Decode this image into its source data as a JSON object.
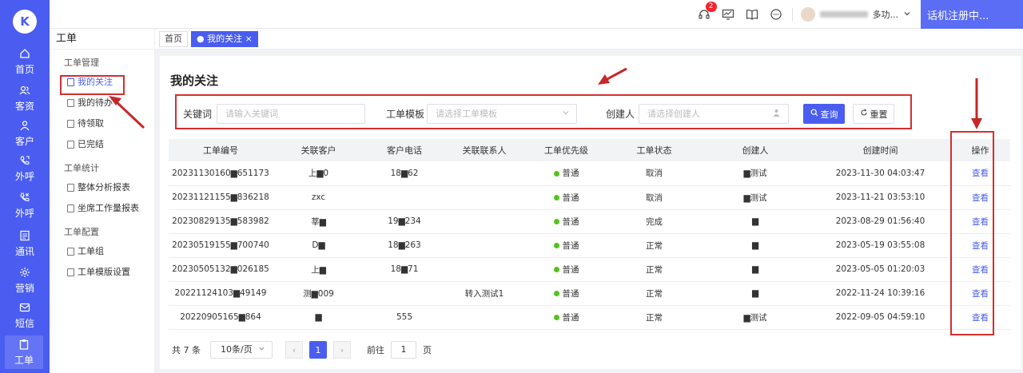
{
  "rail": {
    "logo": "K",
    "items": [
      {
        "label": "首页",
        "icon": "home-icon"
      },
      {
        "label": "客资",
        "icon": "users-icon"
      },
      {
        "label": "客户",
        "icon": "user-icon"
      },
      {
        "label": "外呼",
        "icon": "phone-out-icon"
      },
      {
        "label": "外呼",
        "icon": "phone-call-icon"
      },
      {
        "label": "通讯",
        "icon": "address-book-icon"
      },
      {
        "label": "营销",
        "icon": "gear-icon"
      },
      {
        "label": "短信",
        "icon": "message-icon"
      },
      {
        "label": "工单",
        "icon": "clipboard-icon"
      }
    ]
  },
  "topbar": {
    "badge": "2",
    "user_text": "多功...",
    "register_label": "话机注册中..."
  },
  "sidebar": {
    "title": "工单",
    "groups": [
      {
        "label": "工单管理",
        "items": [
          "我的关注",
          "我的待办",
          "待领取",
          "已完结"
        ]
      },
      {
        "label": "工单统计",
        "items": [
          "整体分析报表",
          "坐席工作量报表"
        ]
      },
      {
        "label": "工单配置",
        "items": [
          "工单组",
          "工单模版设置"
        ]
      }
    ]
  },
  "tabs": {
    "home": "首页",
    "current": "● 我的关注 ×"
  },
  "page": {
    "title": "我的关注",
    "filter": {
      "keyword_label": "关键词",
      "keyword_placeholder": "请输入关键词",
      "template_label": "工单模板",
      "template_placeholder": "请选择工单模板",
      "creator_label": "创建人",
      "creator_placeholder": "请选择创建人",
      "query": "查询",
      "reset": "重置"
    },
    "table": {
      "headers": [
        "工单编号",
        "关联客户",
        "客户电话",
        "关联联系人",
        "工单优先级",
        "工单状态",
        "创建人",
        "创建时间",
        "操作"
      ],
      "rows": [
        [
          "20231130160▆651173",
          "上▆0",
          "18▆62",
          "",
          "普通",
          "取消",
          "▆测试",
          "2023-11-30 04:03:47",
          "查看"
        ],
        [
          "20231121155▆836218",
          "zxc",
          "",
          "",
          "普通",
          "取消",
          "▆测试",
          "2023-11-21 03:53:10",
          "查看"
        ],
        [
          "20230829135▆583982",
          "莘▆",
          "19▆234",
          "",
          "普通",
          "完成",
          "▆",
          "2023-08-29 01:56:40",
          "查看"
        ],
        [
          "20230519155▆700740",
          "D▆",
          "18▆263",
          "",
          "普通",
          "正常",
          "▆",
          "2023-05-19 03:55:08",
          "查看"
        ],
        [
          "20230505132▆026185",
          "上▆",
          "18▆71",
          "",
          "普通",
          "正常",
          "▆",
          "2023-05-05 01:20:03",
          "查看"
        ],
        [
          "20221124103▆49149",
          "测▆009",
          "",
          "转入测试1",
          "普通",
          "正常",
          "▆",
          "2022-11-24 10:39:16",
          "查看"
        ],
        [
          "20220905165▆864",
          "▆",
          "555",
          "",
          "普通",
          "正常",
          "▆测试",
          "2022-09-05 04:59:10",
          "查看"
        ]
      ]
    },
    "pager": {
      "total": "共 7 条",
      "size": "10条/页",
      "page": "1",
      "goto": "前往",
      "goto_value": "1",
      "unit": "页"
    }
  }
}
